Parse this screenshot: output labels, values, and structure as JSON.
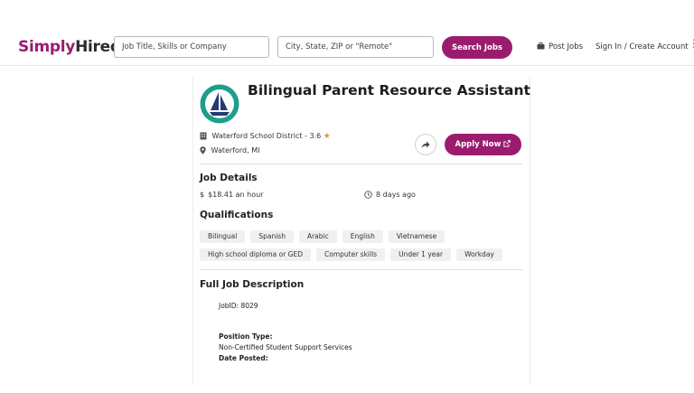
{
  "header": {
    "logo_part1": "Simply",
    "logo_part2": "Hired.",
    "search_placeholder": "Job Title, Skills or Company",
    "location_placeholder": "City, State, ZIP or \"Remote\"",
    "search_button": "Search Jobs",
    "post_jobs": "Post Jobs",
    "sign_in": "Sign In / Create Account",
    "more_icon": "⋮"
  },
  "job": {
    "title": "Bilingual Parent Resource Assistant",
    "company": "Waterford School District",
    "rating_sep": " - ",
    "rating": "3.6",
    "star": "★",
    "location": "Waterford, MI",
    "apply_label": "Apply Now",
    "icons": {
      "company": "building-icon",
      "location": "map-pin-icon",
      "share": "share-arrow-icon",
      "external": "external-link-icon",
      "posted": "clock-icon",
      "logo": "sailboat-logo"
    },
    "colors": {
      "brand": "#9b1c6e",
      "logo_teal": "#1f9e8c",
      "logo_navy": "#233a72",
      "star": "#c9a23a"
    }
  },
  "details": {
    "title": "Job Details",
    "pay_symbol": "$",
    "pay": "$18.41 an hour",
    "posted": "8 days ago"
  },
  "qualifications": {
    "title": "Qualifications",
    "rows": [
      [
        "Bilingual",
        "Spanish",
        "Arabic",
        "English",
        "Vietnamese"
      ],
      [
        "High school diploma or GED",
        "Computer skills",
        "Under 1 year",
        "Workday"
      ]
    ]
  },
  "description": {
    "title": "Full Job Description",
    "job_id": "JobID: 8029",
    "position_type_label": "Position Type:",
    "position_type_value": "Non-Certified Student Support Services",
    "date_posted_label": "Date Posted:"
  }
}
